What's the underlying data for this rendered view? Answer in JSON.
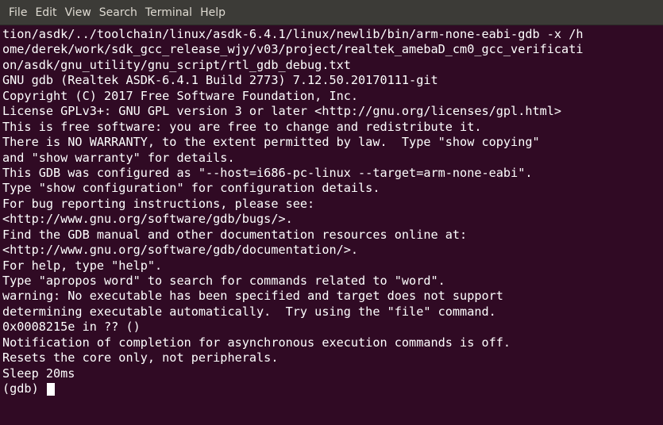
{
  "menu": {
    "items": [
      "File",
      "Edit",
      "View",
      "Search",
      "Terminal",
      "Help"
    ]
  },
  "terminal": {
    "lines": [
      "tion/asdk/../toolchain/linux/asdk-6.4.1/linux/newlib/bin/arm-none-eabi-gdb -x /h",
      "ome/derek/work/sdk_gcc_release_wjy/v03/project/realtek_amebaD_cm0_gcc_verificati",
      "on/asdk/gnu_utility/gnu_script/rtl_gdb_debug.txt",
      "GNU gdb (Realtek ASDK-6.4.1 Build 2773) 7.12.50.20170111-git",
      "Copyright (C) 2017 Free Software Foundation, Inc.",
      "License GPLv3+: GNU GPL version 3 or later <http://gnu.org/licenses/gpl.html>",
      "This is free software: you are free to change and redistribute it.",
      "There is NO WARRANTY, to the extent permitted by law.  Type \"show copying\"",
      "and \"show warranty\" for details.",
      "This GDB was configured as \"--host=i686-pc-linux --target=arm-none-eabi\".",
      "Type \"show configuration\" for configuration details.",
      "For bug reporting instructions, please see:",
      "<http://www.gnu.org/software/gdb/bugs/>.",
      "Find the GDB manual and other documentation resources online at:",
      "<http://www.gnu.org/software/gdb/documentation/>.",
      "For help, type \"help\".",
      "Type \"apropos word\" to search for commands related to \"word\".",
      "warning: No executable has been specified and target does not support",
      "determining executable automatically.  Try using the \"file\" command.",
      "0x0008215e in ?? ()",
      "Notification of completion for asynchronous execution commands is off.",
      "Resets the core only, not peripherals.",
      "Sleep 20ms"
    ],
    "prompt": "(gdb) "
  }
}
